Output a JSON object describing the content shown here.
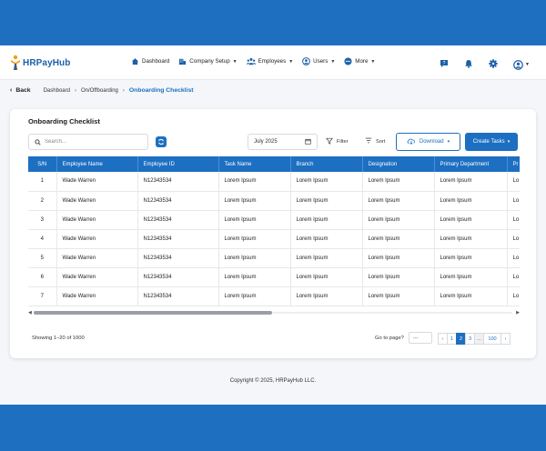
{
  "brand": {
    "name": "HRPayHub",
    "accent": "#1d6fc1"
  },
  "nav": {
    "items": [
      {
        "label": "Dashboard",
        "icon": "home-icon",
        "has_caret": false
      },
      {
        "label": "Company Setup",
        "icon": "building-icon",
        "has_caret": true
      },
      {
        "label": "Employees",
        "icon": "people-icon",
        "has_caret": true
      },
      {
        "label": "Users",
        "icon": "user-circle-icon",
        "has_caret": true
      },
      {
        "label": "More",
        "icon": "more-icon",
        "has_caret": true
      }
    ],
    "right_icons": [
      "help-chat-icon",
      "bell-icon",
      "gear-icon",
      "avatar-icon"
    ]
  },
  "breadcrumb": {
    "back_label": "Back",
    "items": [
      "Dashboard",
      "On/Offboarding"
    ],
    "current": "Onboarding Checklist"
  },
  "card": {
    "title": "Onboarding Checklist",
    "search_placeholder": "Search...",
    "date_value": "July 2025",
    "filter_label": "Filter",
    "sort_label": "Sort",
    "download_label": "Download",
    "create_label": "Create Tasks"
  },
  "table": {
    "columns": [
      "S/N",
      "Employee Name",
      "Employee ID",
      "Task Name",
      "Branch",
      "Designation",
      "Primary Department",
      "Pr"
    ],
    "rows": [
      [
        "1",
        "Wade Warren",
        "N12343534",
        "Lorem Ipsum",
        "Lorem Ipsum",
        "Lorem Ipsum",
        "Lorem Ipsum",
        "Lo"
      ],
      [
        "2",
        "Wade Warren",
        "N12343534",
        "Lorem Ipsum",
        "Lorem Ipsum",
        "Lorem Ipsum",
        "Lorem Ipsum",
        "Lo"
      ],
      [
        "3",
        "Wade Warren",
        "N12343534",
        "Lorem Ipsum",
        "Lorem Ipsum",
        "Lorem Ipsum",
        "Lorem Ipsum",
        "Lo"
      ],
      [
        "4",
        "Wade Warren",
        "N12343534",
        "Lorem Ipsum",
        "Lorem Ipsum",
        "Lorem Ipsum",
        "Lorem Ipsum",
        "Lo"
      ],
      [
        "5",
        "Wade Warren",
        "N12343534",
        "Lorem Ipsum",
        "Lorem Ipsum",
        "Lorem Ipsum",
        "Lorem Ipsum",
        "Lo"
      ],
      [
        "6",
        "Wade Warren",
        "N12343534",
        "Lorem Ipsum",
        "Lorem Ipsum",
        "Lorem Ipsum",
        "Lorem Ipsum",
        "Lo"
      ],
      [
        "7",
        "Wade Warren",
        "N12343534",
        "Lorem Ipsum",
        "Lorem Ipsum",
        "Lorem Ipsum",
        "Lorem Ipsum",
        "Lo"
      ]
    ]
  },
  "pagination": {
    "showing_text": "Showing 1–20 of 1000",
    "goto_label": "Go to page?",
    "goto_value": "---",
    "prev": "‹",
    "pages": [
      "1",
      "2",
      "3",
      "...",
      "100"
    ],
    "active_page": "2",
    "next": "›"
  },
  "footer": {
    "copyright": "Copyright © 2025, HRPayHub LLC."
  }
}
